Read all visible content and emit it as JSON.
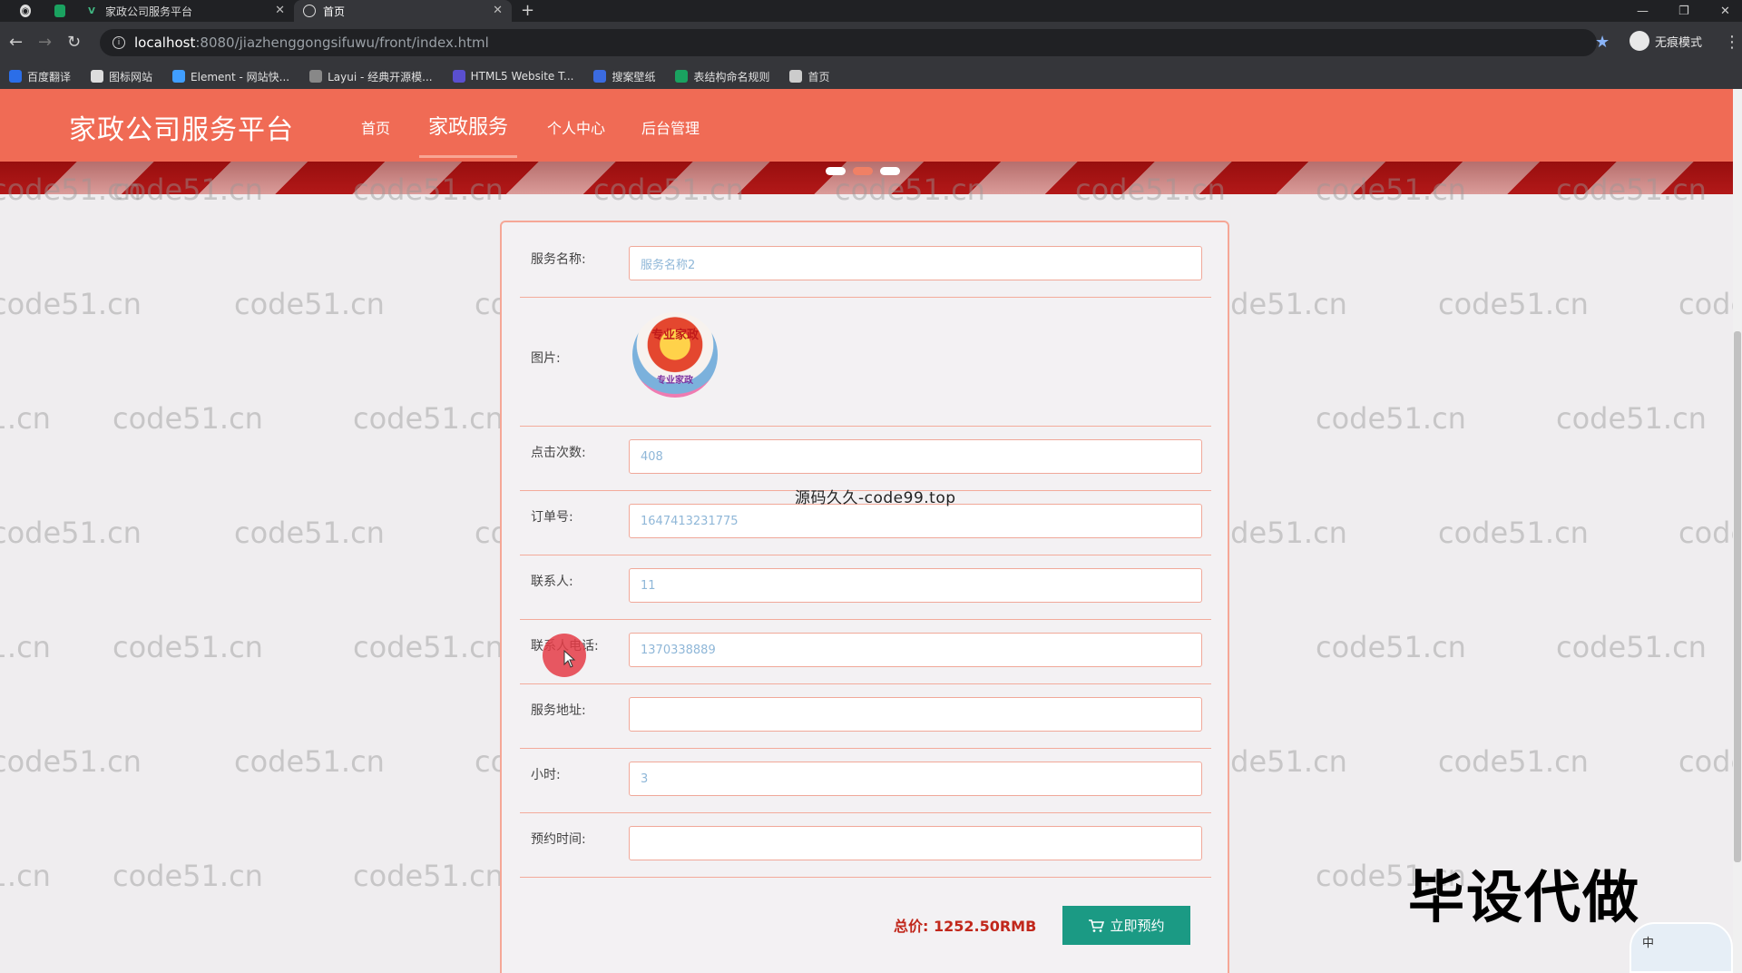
{
  "browser": {
    "tabs": [
      {
        "label": "家政公司服务平台",
        "active": false
      },
      {
        "label": "首页",
        "active": true
      }
    ],
    "url_host": "localhost",
    "url_path": ":8080/jiazhenggongsifuwu/front/index.html",
    "incognito_label": "无痕模式",
    "bookmarks": [
      {
        "label": "百度翻译",
        "color": "#2b6ee8"
      },
      {
        "label": "图标网站",
        "color": "#dddddd"
      },
      {
        "label": "Element - 网站快...",
        "color": "#409eff"
      },
      {
        "label": "Layui - 经典开源模...",
        "color": "#888888"
      },
      {
        "label": "HTML5 Website T...",
        "color": "#5a4fcf"
      },
      {
        "label": "搜案壁纸",
        "color": "#3b6be0"
      },
      {
        "label": "表结构命名规则",
        "color": "#1aa260"
      },
      {
        "label": "首页",
        "color": "#cccccc"
      }
    ]
  },
  "site": {
    "title": "家政公司服务平台",
    "nav": [
      "首页",
      "家政服务",
      "个人中心",
      "后台管理"
    ],
    "active_nav": "家政服务",
    "accent": "#f06b55"
  },
  "form": {
    "fields": [
      {
        "label": "服务名称:",
        "value": "服务名称2",
        "type": "text"
      },
      {
        "label": "图片:",
        "type": "image",
        "image_text": [
          "专业家政",
          "专业家政"
        ]
      },
      {
        "label": "点击次数:",
        "value": "408",
        "type": "text"
      },
      {
        "label": "订单号:",
        "value": "1647413231775",
        "type": "text"
      },
      {
        "label": "联系人:",
        "value": "11",
        "type": "text"
      },
      {
        "label": "联系人电话:",
        "value": "1370338889",
        "type": "text"
      },
      {
        "label": "服务地址:",
        "value": "",
        "type": "text"
      },
      {
        "label": "小时:",
        "value": "3",
        "type": "text"
      },
      {
        "label": "预约时间:",
        "value": "",
        "type": "text"
      }
    ],
    "total_label": "总价:",
    "total_value": "1252.50RMB",
    "book_button": "立即预约"
  },
  "overlay": {
    "center_text": "源码久久-code99.top",
    "corner_text": "毕设代做",
    "watermark": "code51.cn"
  },
  "widget": {
    "label": "中"
  }
}
